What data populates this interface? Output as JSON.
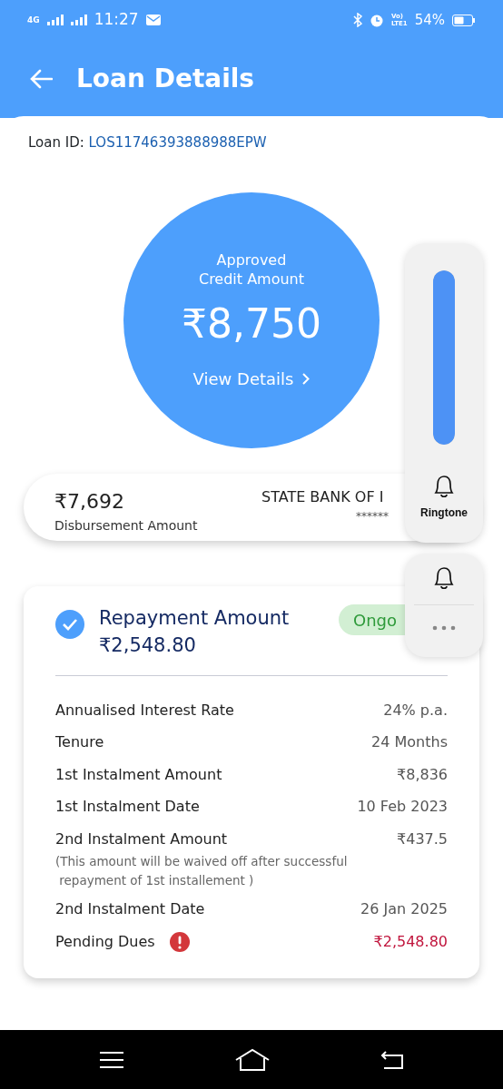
{
  "status_bar": {
    "network": "4G",
    "time": "11:27",
    "volte_lines": [
      "Vo)",
      "LTE1"
    ],
    "battery": "54%"
  },
  "header": {
    "title": "Loan Details"
  },
  "loan_id": {
    "label": "Loan ID:",
    "value": "LOS11746393888988EPW"
  },
  "credit": {
    "title_lines": [
      "Approved",
      "Credit Amount"
    ],
    "amount": "₹8,750",
    "link": "View Details"
  },
  "disbursement": {
    "amount": "₹7,692",
    "label": "Disbursement Amount",
    "bank": "STATE BANK OF I",
    "account": "******"
  },
  "repayment": {
    "title": "Repayment Amount",
    "amount": "₹2,548.80",
    "status": "Ongo",
    "checked": true,
    "rows": [
      {
        "label": "Annualised Interest Rate",
        "value": "24% p.a."
      },
      {
        "label": "Tenure",
        "value": "24 Months"
      },
      {
        "label": "1st Instalment Amount",
        "value": "₹8,836"
      },
      {
        "label": "1st Instalment Date",
        "value": "10 Feb 2023"
      },
      {
        "label": "2nd Instalment Amount",
        "value": "₹437.5",
        "note": "(This amount will be waived off after successful\n repayment of 1st installement )"
      },
      {
        "label": "2nd Instalment Date",
        "value": "26 Jan 2025"
      },
      {
        "label": "Pending Dues",
        "value": "₹2,548.80",
        "alert": true
      }
    ]
  },
  "volume_panel": {
    "level": 1,
    "label": "Ringtone"
  }
}
